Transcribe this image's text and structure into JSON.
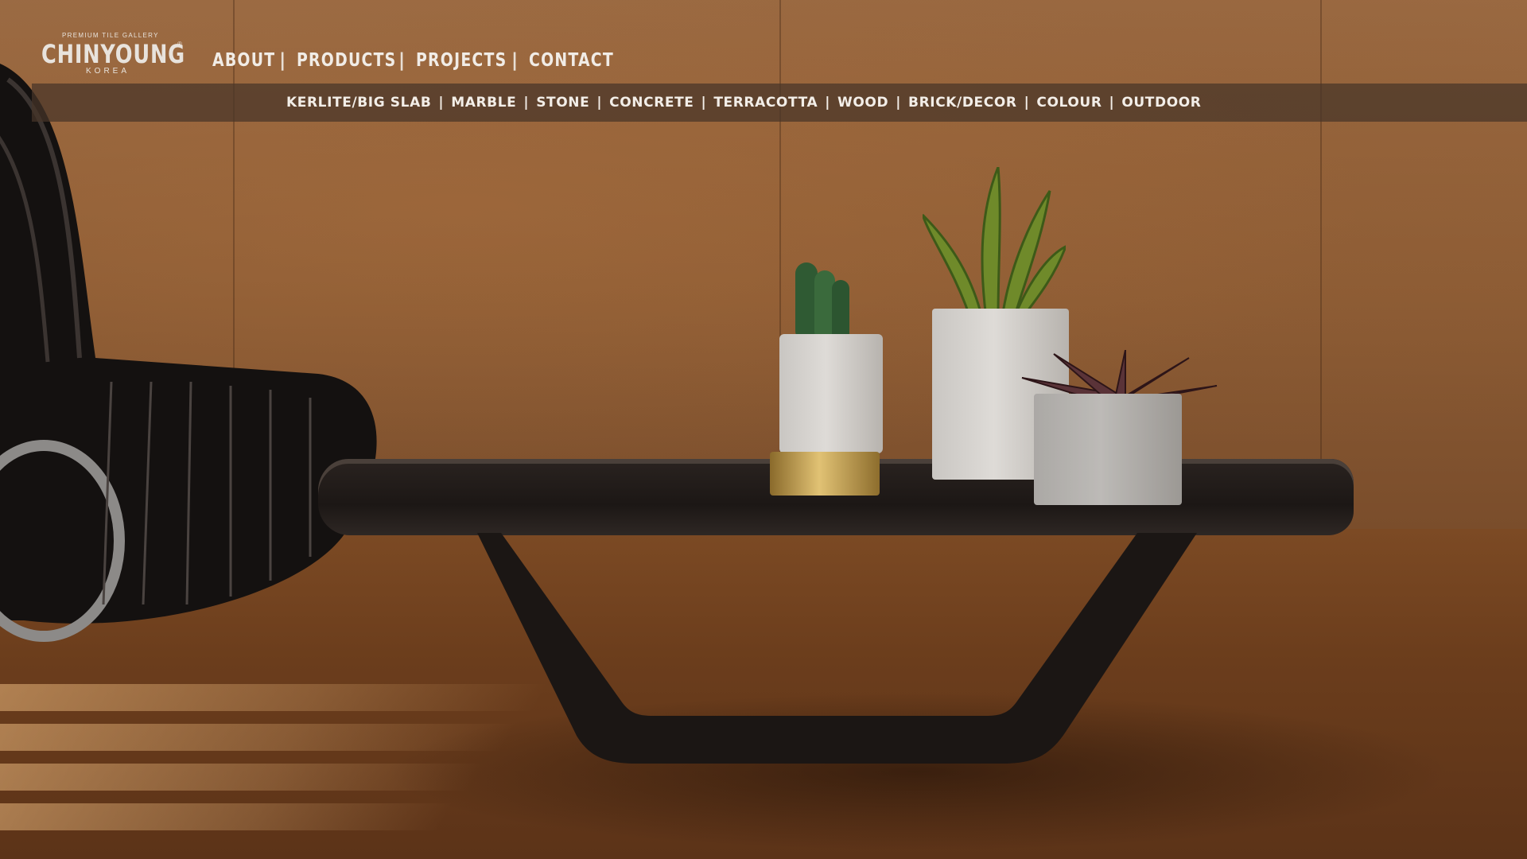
{
  "logo": {
    "tagline": "PREMIUM TILE GALLERY",
    "name": "CHINYOUNG",
    "country": "KOREA",
    "reg": "®"
  },
  "main_nav": {
    "items": [
      "ABOUT",
      "PRODUCTS",
      "PROJECTS",
      "CONTACT"
    ],
    "separator": "|"
  },
  "sub_nav": {
    "items": [
      "KERLITE/BIG SLAB",
      "MARBLE",
      "STONE",
      "CONCRETE",
      "TERRACOTTA",
      "WOOD",
      "BRICK/DECOR",
      "COLOUR",
      "OUTDOOR"
    ],
    "separator": "|"
  },
  "colors": {
    "nav_text": "#f1ece6",
    "subnav_bar": "rgba(70,52,40,0.72)",
    "wall": "#8c5c35",
    "floor": "#6b3d1c"
  }
}
